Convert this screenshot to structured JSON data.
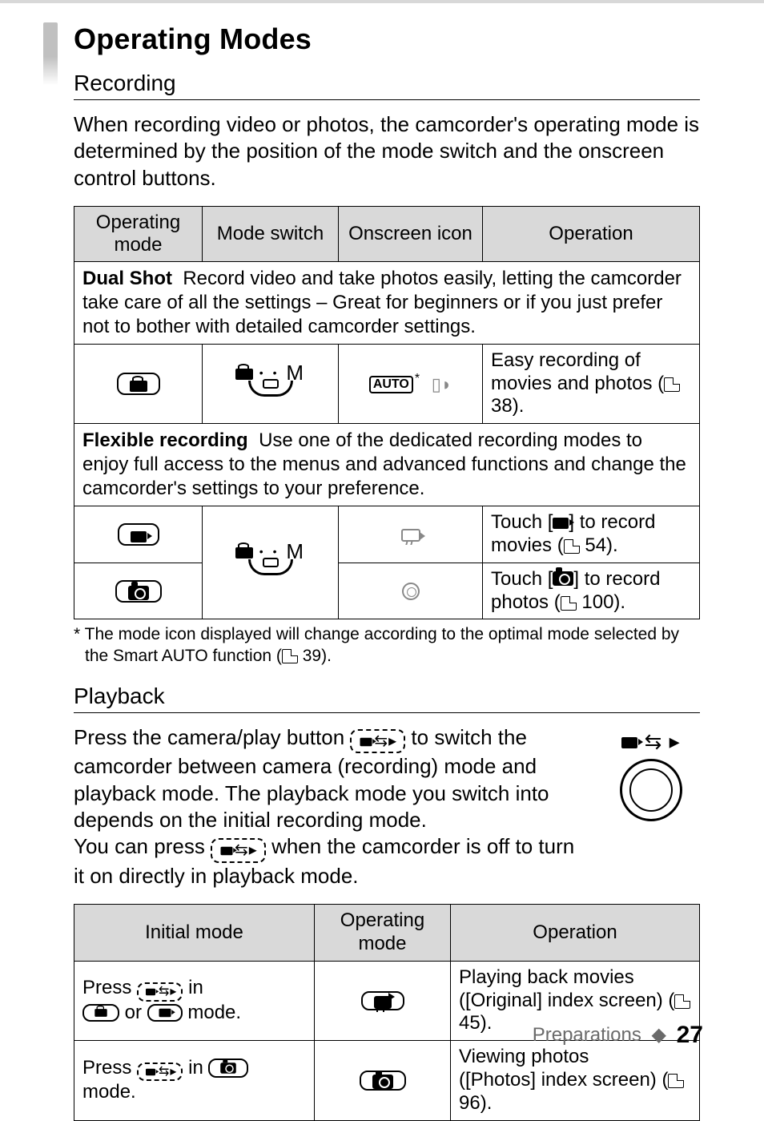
{
  "heading": "Operating Modes",
  "recording": {
    "title": "Recording",
    "intro": "When recording video or photos, the camcorder's operating mode is determined by the position of the mode switch and the onscreen control buttons.",
    "table": {
      "headers": {
        "c1": "Operating mode",
        "c2": "Mode switch",
        "c3": "Onscreen icon",
        "c4": "Operation"
      },
      "dual_shot": {
        "label": "Dual Shot",
        "text": "Record video and take photos easily, letting the camcorder take care of all the settings – Great for beginners or if you just prefer not to bother with detailed camcorder settings.",
        "onscreen_auto": "AUTO",
        "operation_a": "Easy recording of movies and photos (",
        "operation_b": " 38)."
      },
      "flexible": {
        "label": "Flexible recording",
        "text": "Use one of the dedicated recording modes to enjoy full access to the menus and advanced functions and change the camcorder's settings to your preference.",
        "movie_op_a": "Touch [",
        "movie_op_b": "] to record movies (",
        "movie_op_c": " 54).",
        "photo_op_a": "Touch [",
        "photo_op_b": "] to record  photos (",
        "photo_op_c": " 100)."
      },
      "dial_top": "M"
    },
    "footnote": "*  The mode icon displayed will change according to the optimal mode selected by the Smart AUTO function (",
    "footnote_pg": " 39)."
  },
  "playback": {
    "title": "Playback",
    "para_a": "Press the camera/play button ",
    "para_b": " to switch the camcorder between camera (recording) mode and playback mode. The playback mode you switch into depends on the initial recording mode.",
    "para2_a": "You can press ",
    "para2_b": " when the camcorder is off to turn it on directly in playback mode.",
    "cam_play_glyphs": "▮◂▸",
    "table": {
      "headers": {
        "c1": "Initial mode",
        "c2": "Operating mode",
        "c3": "Operation"
      },
      "row1": {
        "a": "Press ",
        "b": " in ",
        "c": " or ",
        "d": " mode.",
        "op_a": "Playing back movies",
        "op_b": "([Original] index screen) (",
        "op_c": " 45)."
      },
      "row2": {
        "a": "Press ",
        "b": " in ",
        "c": " mode.",
        "op_a": "Viewing photos",
        "op_b": "([Photos] index screen) (",
        "op_c": " 96)."
      }
    }
  },
  "footer": {
    "chapter": "Preparations",
    "page": "27"
  }
}
